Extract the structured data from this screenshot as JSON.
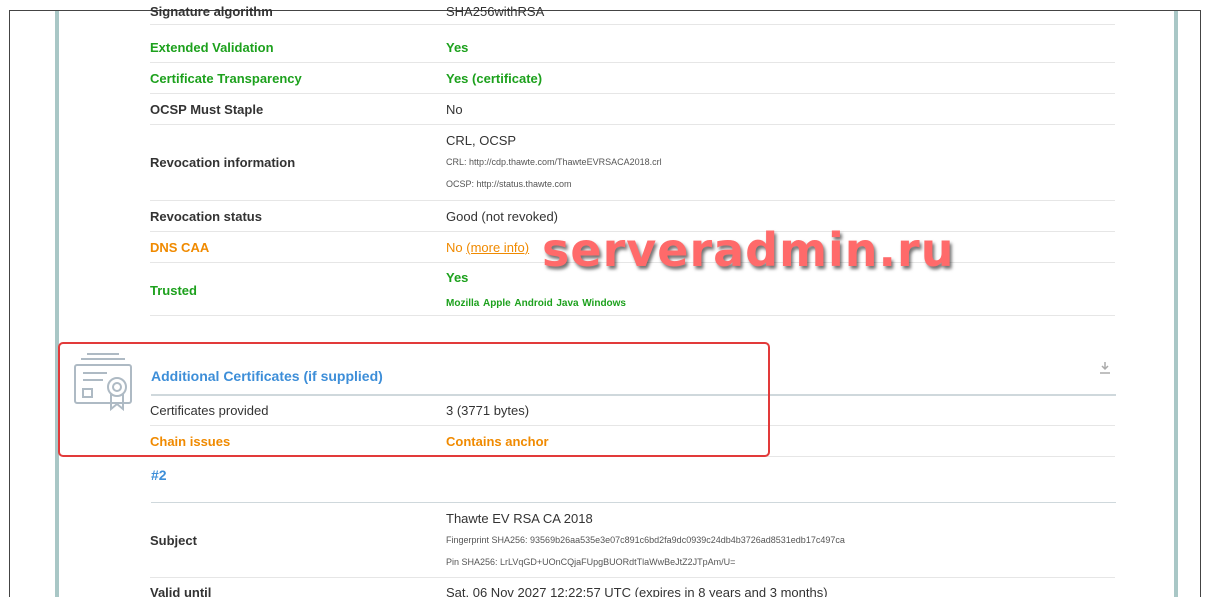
{
  "watermark": "serveradmin.ru",
  "rows_top": [
    {
      "label": "Signature algorithm",
      "value": "SHA256withRSA"
    },
    {
      "label": "Extended Validation",
      "value": "Yes"
    },
    {
      "label": "Certificate Transparency",
      "value": "Yes (certificate)"
    },
    {
      "label": "OCSP Must Staple",
      "value": "No"
    },
    {
      "label": "Revocation information",
      "value": "CRL, OCSP",
      "crl": "CRL: http://cdp.thawte.com/ThawteEVRSACA2018.crl",
      "ocsp": "OCSP: http://status.thawte.com"
    },
    {
      "label": "Revocation status",
      "value": "Good (not revoked)"
    },
    {
      "label": "DNS CAA",
      "value": "No",
      "link": "(more info)"
    },
    {
      "label": "Trusted",
      "value": "Yes",
      "stores": [
        "Mozilla",
        "Apple",
        "Android",
        "Java",
        "Windows"
      ]
    }
  ],
  "additional": {
    "title": "Additional Certificates (if supplied)",
    "rows": [
      {
        "label": "Certificates provided",
        "value": "3 (3771 bytes)"
      },
      {
        "label": "Chain issues",
        "value": "Contains anchor"
      }
    ]
  },
  "cert2": {
    "heading": "#2",
    "subject_label": "Subject",
    "subject_value": "Thawte EV RSA CA 2018",
    "fingerprint": "Fingerprint SHA256: 93569b26aa535e3e07c891c6bd2fa9dc0939c24db4b3726ad8531edb17c497ca",
    "pin": "Pin SHA256: LrLVqGD+UOnCQjaFUpgBUORdtTlaWwBeJtZ2JTpAm/U=",
    "valid_label": "Valid until",
    "valid_value": "Sat, 06 Nov 2027 12:22:57 UTC (expires in 8 years and 3 months)"
  }
}
